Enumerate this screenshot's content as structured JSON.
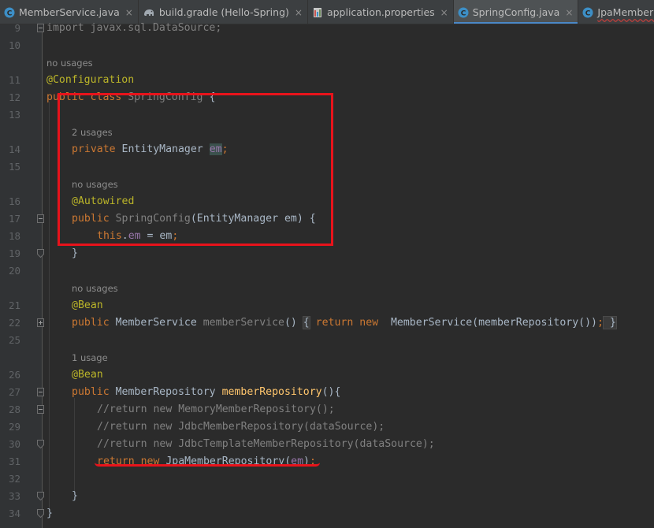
{
  "tabs": [
    {
      "label": "MemberService.java",
      "icon": "java-class-icon",
      "active": false
    },
    {
      "label": "build.gradle (Hello-Spring)",
      "icon": "gradle-elephant-icon",
      "active": false
    },
    {
      "label": "application.properties",
      "icon": "properties-file-icon",
      "active": false
    },
    {
      "label": "SpringConfig.java",
      "icon": "java-class-icon",
      "active": true
    },
    {
      "label": "JpaMemberRepository.java",
      "icon": "java-class-icon",
      "active": false
    }
  ],
  "close_glyph": "×",
  "lines": {
    "l9": {
      "no": "9",
      "text": "import javax.sql.DataSource;"
    },
    "l10": {
      "no": "10"
    },
    "h1": {
      "text": "no usages"
    },
    "l11": {
      "no": "11",
      "text": "@Configuration"
    },
    "l12": {
      "no": "12",
      "a": "public class ",
      "b": "SpringConfig",
      "c": " {"
    },
    "l13": {
      "no": "13"
    },
    "h2": {
      "text": "2 usages"
    },
    "l14": {
      "no": "14",
      "a": "private ",
      "b": "EntityManager ",
      "c": "em",
      "d": ";"
    },
    "l15": {
      "no": "15"
    },
    "h3": {
      "text": "no usages"
    },
    "l16": {
      "no": "16",
      "text": "@Autowired"
    },
    "l17": {
      "no": "17",
      "a": "public ",
      "b": "SpringConfig",
      "c": "(EntityManager em) {"
    },
    "l18": {
      "no": "18",
      "a": "this",
      "b": ".",
      "c": "em",
      "d": " = em",
      "e": ";"
    },
    "l19": {
      "no": "19",
      "text": "}"
    },
    "l20": {
      "no": "20"
    },
    "h4": {
      "text": "no usages"
    },
    "l21": {
      "no": "21",
      "text": "@Bean"
    },
    "l22": {
      "no": "22",
      "a": "public ",
      "b": "MemberService ",
      "c": "memberService",
      "d": "() ",
      "e": "{",
      "f": " return new ",
      "g": "MemberService(memberRepository())",
      "h": ";",
      "i": " }"
    },
    "l25": {
      "no": "25"
    },
    "h5": {
      "text": "1 usage"
    },
    "l26": {
      "no": "26",
      "text": "@Bean"
    },
    "l27": {
      "no": "27",
      "a": "public ",
      "b": "MemberRepository ",
      "c": "memberRepository",
      "d": "(){"
    },
    "l28": {
      "no": "28",
      "text": "//return new MemoryMemberRepository();"
    },
    "l29": {
      "no": "29",
      "text": "//return new JdbcMemberRepository(dataSource);"
    },
    "l30": {
      "no": "30",
      "text": "//return new JdbcTemplateMemberRepository(dataSource);"
    },
    "l31": {
      "no": "31",
      "a": "return new ",
      "b": "JpaMemberRepository(",
      "c": "em",
      "d": ")",
      "e": ";"
    },
    "l32": {
      "no": "32"
    },
    "l33": {
      "no": "33",
      "text": "}"
    },
    "l34": {
      "no": "34",
      "text": "}"
    }
  },
  "colors": {
    "annotation": "#e8131b",
    "keyword": "#cc7832",
    "annotation_token": "#bbb529",
    "field": "#9876aa",
    "method": "#ffc66d",
    "comment": "#808080"
  }
}
